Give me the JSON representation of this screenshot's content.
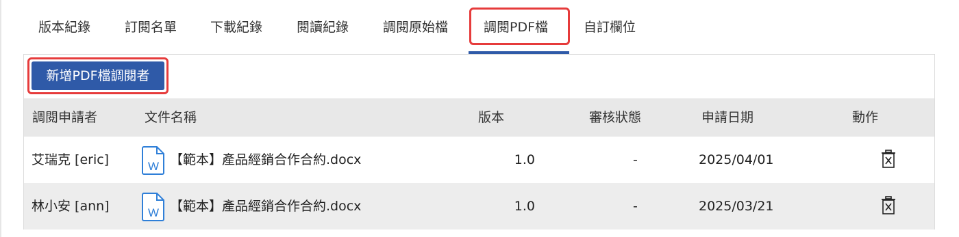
{
  "tabs": [
    {
      "label": "版本紀錄"
    },
    {
      "label": "訂閱名單"
    },
    {
      "label": "下載紀錄"
    },
    {
      "label": "閱讀紀錄"
    },
    {
      "label": "調閱原始檔"
    },
    {
      "label": "調閱PDF檔",
      "active": true
    },
    {
      "label": "自訂欄位"
    }
  ],
  "actions": {
    "add_label": "新增PDF檔調閱者"
  },
  "table": {
    "headers": [
      "調閱申請者",
      "文件名稱",
      "版本",
      "審核狀態",
      "申請日期",
      "動作"
    ],
    "rows": [
      {
        "requester": "艾瑞克 [eric]",
        "document": "【範本】產品經銷合作合約.docx",
        "version": "1.0",
        "status": "-",
        "date": "2025/04/01"
      },
      {
        "requester": "林小安 [ann]",
        "document": "【範本】產品經銷合作合約.docx",
        "version": "1.0",
        "status": "-",
        "date": "2025/03/21"
      }
    ]
  },
  "colors": {
    "accent": "#2f5aa8",
    "highlight": "#e63b3b",
    "header_bg": "#e8e8e8",
    "alt_row_bg": "#ededed",
    "word_icon": "#2f7fd8"
  },
  "icons": [
    "word-document-icon",
    "trash-icon"
  ]
}
